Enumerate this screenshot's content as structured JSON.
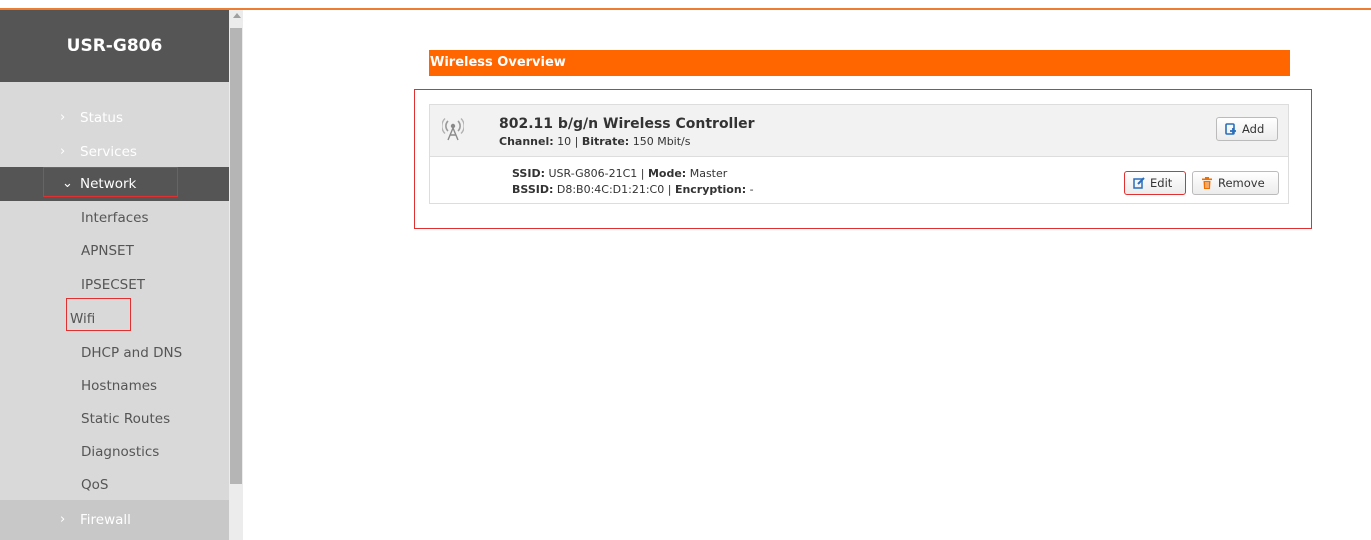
{
  "sidebar": {
    "brand": "USR-G806",
    "top_items": [
      {
        "label": "Status",
        "expanded": false
      },
      {
        "label": "Services",
        "expanded": false
      },
      {
        "label": "Network",
        "expanded": true
      },
      {
        "label": "Firewall",
        "expanded": false
      }
    ],
    "network_sub": [
      "Interfaces",
      "APNSET",
      "IPSECSET",
      "Wifi",
      "DHCP and DNS",
      "Hostnames",
      "Static Routes",
      "Diagnostics",
      "QoS"
    ]
  },
  "main": {
    "section_title": "Wireless Overview",
    "controller": {
      "name": "802.11 b/g/n Wireless Controller",
      "channel_label": "Channel:",
      "channel_value": "10",
      "bitrate_label": "Bitrate:",
      "bitrate_value": "150 Mbit/s",
      "add_label": "Add"
    },
    "network": {
      "ssid_label": "SSID:",
      "ssid_value": "USR-G806-21C1",
      "mode_label": "Mode:",
      "mode_value": "Master",
      "bssid_label": "BSSID:",
      "bssid_value": "D8:B0:4C:D1:21:C0",
      "encryption_label": "Encryption:",
      "encryption_value": "-",
      "edit_label": "Edit",
      "remove_label": "Remove"
    }
  },
  "colors": {
    "accent": "#ff6600",
    "sidebar_dark": "#555555",
    "sidebar_bg": "#d9d9d9",
    "highlight": "#e03030",
    "edit_icon": "#2a6ebb",
    "remove_icon": "#ee6f00"
  },
  "icons": [
    "chevron-right-icon",
    "chevron-down-icon",
    "antenna-icon",
    "add-icon",
    "edit-icon",
    "trash-icon"
  ]
}
